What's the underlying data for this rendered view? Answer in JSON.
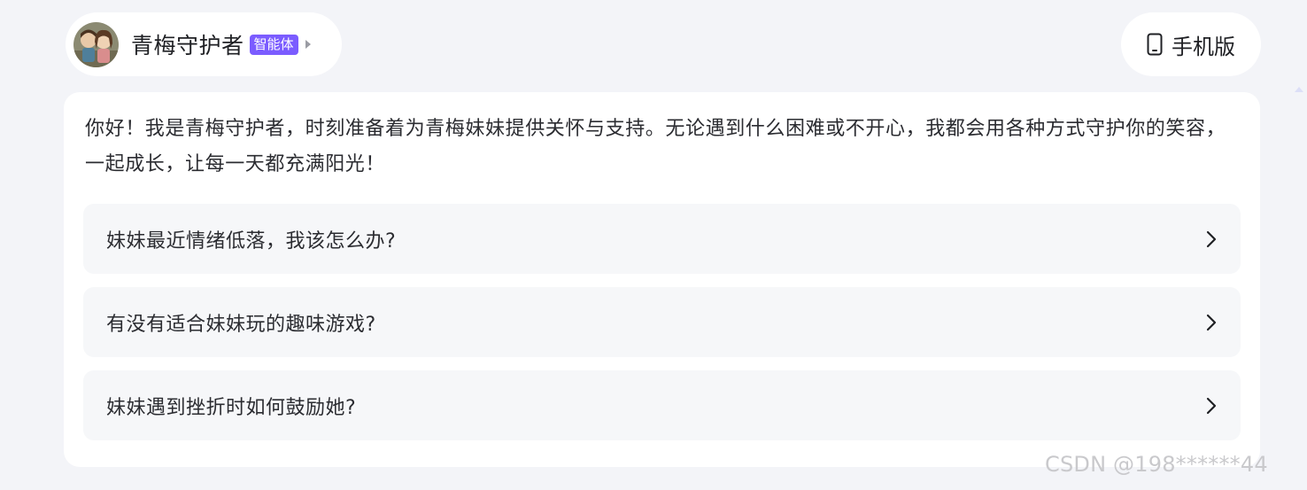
{
  "header": {
    "agent_name": "青梅守护者",
    "agent_badge": "智能体",
    "mobile_label": "手机版"
  },
  "intro": "你好！我是青梅守护者，时刻准备着为青梅妹妹提供关怀与支持。无论遇到什么困难或不开心，我都会用各种方式守护你的笑容，一起成长，让每一天都充满阳光！",
  "suggestions": [
    "妹妹最近情绪低落，我该怎么办?",
    "有没有适合妹妹玩的趣味游戏?",
    "妹妹遇到挫折时如何鼓励她?"
  ],
  "watermark": "CSDN @198******44",
  "colors": {
    "badge": "#7b5cff",
    "page_bg": "#f3f4f8",
    "card_bg": "#ffffff",
    "suggestion_bg": "#f6f7f9"
  },
  "icons": [
    "avatar-image",
    "caret-right-icon",
    "mobile-phone-icon",
    "chevron-right-icon"
  ]
}
